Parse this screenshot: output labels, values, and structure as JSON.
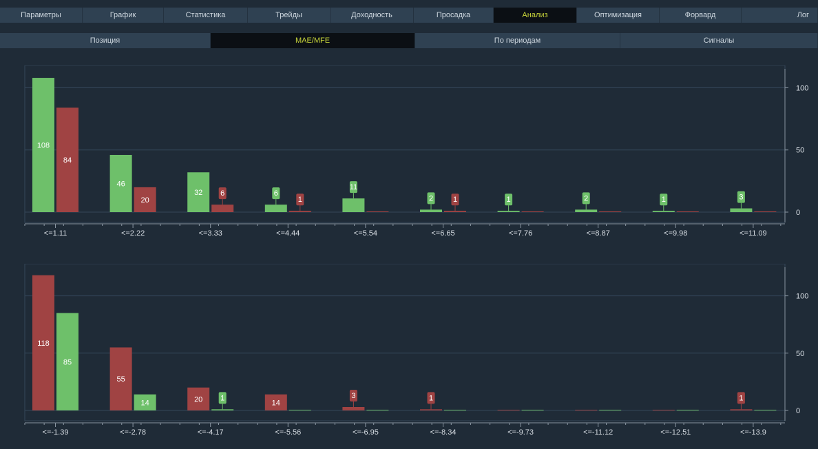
{
  "tabs": [
    {
      "label": "Параметры",
      "active": false
    },
    {
      "label": "График",
      "active": false
    },
    {
      "label": "Статистика",
      "active": false
    },
    {
      "label": "Трейды",
      "active": false
    },
    {
      "label": "Доходность",
      "active": false
    },
    {
      "label": "Просадка",
      "active": false
    },
    {
      "label": "Анализ",
      "active": true
    },
    {
      "label": "Оптимизация",
      "active": false
    },
    {
      "label": "Форвард",
      "active": false
    },
    {
      "label": "Лог",
      "active": false
    }
  ],
  "subtabs": [
    {
      "label": "Позиция",
      "active": false
    },
    {
      "label": "MAE/MFE",
      "active": true
    },
    {
      "label": "По периодам",
      "active": false
    },
    {
      "label": "Сигналы",
      "active": false
    }
  ],
  "colors": {
    "green": "#6ec06a",
    "red": "#a04343",
    "accent": "#c7d43a"
  },
  "chart_data": [
    {
      "type": "bar",
      "categories": [
        "<=1.11",
        "<=2.22",
        "<=3.33",
        "<=4.44",
        "<=5.54",
        "<=6.65",
        "<=7.76",
        "<=8.87",
        "<=9.98",
        "<=11.09"
      ],
      "series": [
        {
          "color": "green",
          "values": [
            108,
            46,
            32,
            6,
            11,
            2,
            1,
            2,
            1,
            3
          ]
        },
        {
          "color": "red",
          "values": [
            84,
            20,
            6,
            1,
            0,
            1,
            0,
            0,
            0,
            0
          ]
        }
      ],
      "ylim": [
        -7,
        118
      ],
      "yticks": [
        "0",
        "50",
        "100"
      ],
      "grid": true
    },
    {
      "type": "bar",
      "categories": [
        "<=-1.39",
        "<=-2.78",
        "<=-4.17",
        "<=-5.56",
        "<=-6.95",
        "<=-8.34",
        "<=-9.73",
        "<=-11.12",
        "<=-12.51",
        "<=-13.9"
      ],
      "series": [
        {
          "color": "red",
          "values": [
            118,
            55,
            20,
            14,
            3,
            1,
            0,
            0,
            0,
            1
          ]
        },
        {
          "color": "green",
          "values": [
            85,
            14,
            1,
            0,
            0,
            0,
            0,
            0,
            0,
            0
          ]
        }
      ],
      "ylim": [
        -7,
        128
      ],
      "yticks": [
        "0",
        "50",
        "100"
      ],
      "grid": true
    }
  ]
}
